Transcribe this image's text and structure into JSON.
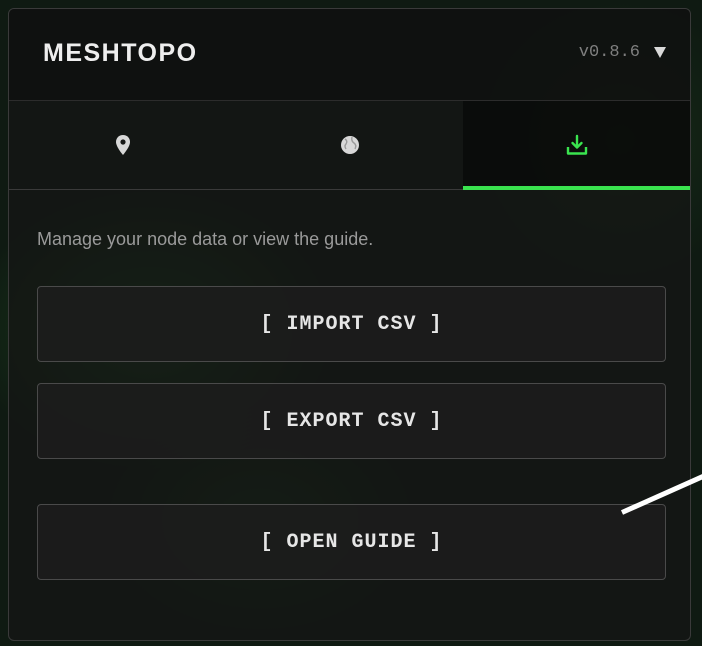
{
  "app": {
    "title": "MESHTOPO",
    "version": "v0.8.6"
  },
  "tabs": [
    {
      "icon": "map-pin-icon",
      "active": false
    },
    {
      "icon": "globe-icon",
      "active": false
    },
    {
      "icon": "download-icon",
      "active": true
    }
  ],
  "colors": {
    "accent": "#3ae34f",
    "panel_bg": "#161816",
    "button_bg": "#1c1c1c",
    "button_border": "#4a4a4a"
  },
  "content": {
    "description": "Manage your node data or view the guide.",
    "buttons": {
      "import": "[ IMPORT CSV ]",
      "export": "[ EXPORT CSV ]",
      "guide": "[ OPEN GUIDE ]"
    }
  }
}
